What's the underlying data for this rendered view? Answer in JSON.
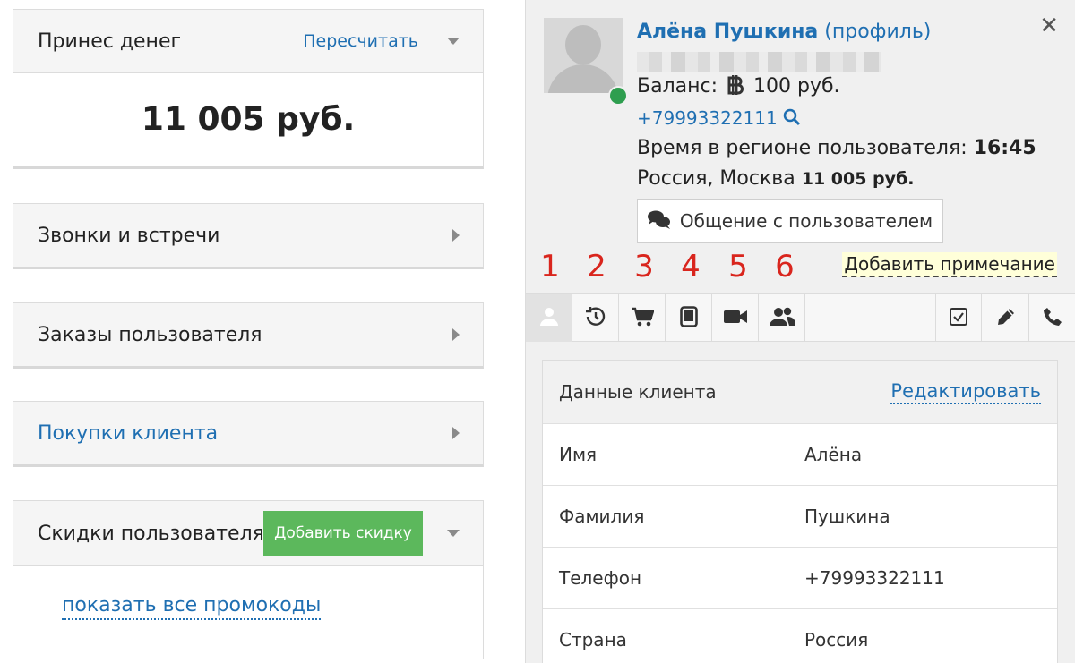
{
  "left": {
    "money_card": {
      "title": "Принес денег",
      "recalc_link": "Пересчитать",
      "value": "11 005 руб."
    },
    "calls_card": {
      "title": "Звонки и встречи"
    },
    "orders_card": {
      "title": "Заказы пользователя"
    },
    "purchases_card": {
      "title": "Покупки клиента"
    },
    "discounts_card": {
      "title": "Скидки пользователя",
      "add_button": "Добавить скидку",
      "promo_link": "показать все промокоды"
    }
  },
  "panel": {
    "name": "Алёна Пушкина",
    "profile_link": "(профиль)",
    "balance_label": "Баланс:",
    "balance_value": "100 руб.",
    "phone": "+79993322111",
    "region_time_label": "Время в регионе пользователя:",
    "region_time_value": "16:45",
    "location": "Россия, Москва",
    "location_money": "11 005 руб.",
    "chat_button": "Общение с пользователем",
    "add_note": "Добавить примечание",
    "close_symbol": "✕",
    "tab_numbers": [
      "1",
      "2",
      "3",
      "4",
      "5",
      "6"
    ],
    "tabs_left": [
      "user-icon",
      "history-icon",
      "cart-icon",
      "tablet-icon",
      "video-icon",
      "group-icon"
    ],
    "tabs_right": [
      "checkbox-icon",
      "pencil-icon",
      "phone-icon"
    ]
  },
  "client_data": {
    "title": "Данные клиента",
    "edit_link": "Редактировать",
    "rows": [
      {
        "label": "Имя",
        "value": "Алёна"
      },
      {
        "label": "Фамилия",
        "value": "Пушкина"
      },
      {
        "label": "Телефон",
        "value": "+79993322111"
      },
      {
        "label": "Страна",
        "value": "Россия"
      }
    ]
  },
  "colors": {
    "link": "#1f6fb2",
    "green_button": "#5cb85c",
    "online": "#2e9e4f",
    "annotation": "#d9251d"
  }
}
